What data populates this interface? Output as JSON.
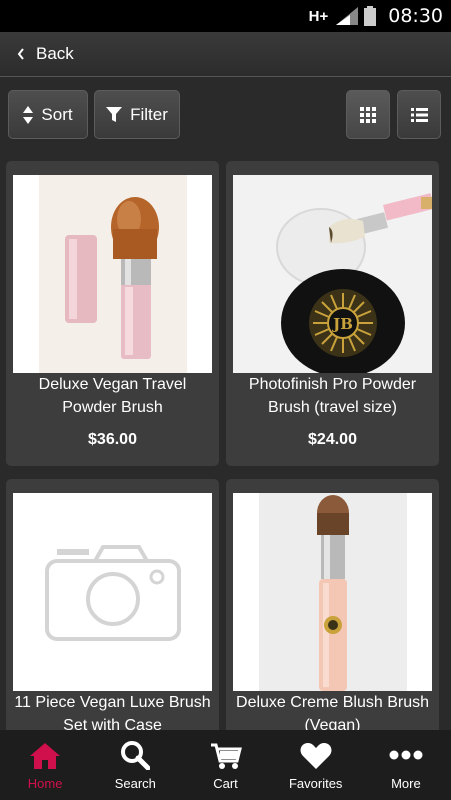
{
  "status": {
    "network": "H+",
    "time": "08:30"
  },
  "nav": {
    "back_label": "Back"
  },
  "toolbar": {
    "sort_label": "Sort",
    "filter_label": "Filter"
  },
  "products": [
    {
      "title": "Deluxe Vegan Travel Powder Brush",
      "price": "$36.00"
    },
    {
      "title": "Photofinish Pro Powder Brush (travel size)",
      "price": "$24.00"
    },
    {
      "title": "11 Piece Vegan Luxe Brush Set with Case",
      "price": ""
    },
    {
      "title": "Deluxe Creme Blush Brush (Vegan)",
      "price": ""
    }
  ],
  "tabs": [
    {
      "label": "Home",
      "icon": "home-icon"
    },
    {
      "label": "Search",
      "icon": "search-icon"
    },
    {
      "label": "Cart",
      "icon": "cart-icon"
    },
    {
      "label": "Favorites",
      "icon": "heart-icon"
    },
    {
      "label": "More",
      "icon": "more-icon"
    }
  ],
  "colors": {
    "accent": "#d0104c",
    "background": "#2a2a2a",
    "card": "#3d3d3d"
  }
}
